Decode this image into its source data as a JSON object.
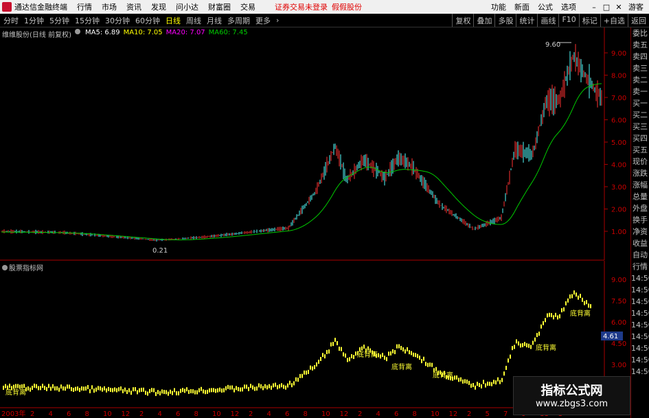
{
  "menubar": {
    "app_title": "通达信金融终端",
    "menus": [
      "行情",
      "市场",
      "资讯",
      "发现",
      "问小达",
      "财富圈",
      "交易"
    ],
    "warning": "证券交易未登录",
    "warning2": "假假股份",
    "right": [
      "功能",
      "新面",
      "公式",
      "选项"
    ],
    "user": "游客"
  },
  "toolbar": {
    "timeframes": [
      "分时",
      "1分钟",
      "5分钟",
      "15分钟",
      "30分钟",
      "60分钟",
      "日线",
      "周线",
      "月线",
      "多周期",
      "更多"
    ],
    "active_timeframe": "日线",
    "right_tools": [
      "复权",
      "叠加",
      "多股",
      "统计",
      "画线",
      "F10",
      "标记",
      "+自选",
      "返回"
    ]
  },
  "main_chart": {
    "stock": "维维股份(日线 前复权)",
    "ma5": "MA5: 6.89",
    "ma10": "MA10: 7.05",
    "ma20": "MA20: 7.07",
    "ma60": "MA60: 7.45",
    "high_label": "9.60",
    "low_label": "0.21",
    "y_ticks": [
      "9.00",
      "8.00",
      "7.00",
      "6.00",
      "5.00",
      "4.00",
      "3.00",
      "2.00",
      "1.00"
    ],
    "ma_colors": {
      "ma5": "#ffffff",
      "ma10": "#ffff00",
      "ma20": "#ff00ff",
      "ma60": "#00cc00"
    }
  },
  "indicator": {
    "title": "股票指标网",
    "y_ticks": [
      "9.00",
      "7.50",
      "6.00",
      "4.50",
      "3.00"
    ],
    "current_value": "4.61",
    "signal_label": "底背离"
  },
  "x_axis": {
    "year_label": "2003年",
    "month_ticks": [
      "2",
      "4",
      "6",
      "8",
      "10",
      "12",
      "2",
      "4",
      "6",
      "8",
      "10",
      "12",
      "2",
      "4",
      "6",
      "8",
      "10",
      "12",
      "2",
      "4",
      "6",
      "8",
      "10",
      "12",
      "2",
      "5",
      "7",
      "9",
      "11",
      "1"
    ]
  },
  "right_panel": {
    "items": [
      "委比",
      "卖五",
      "卖四",
      "卖三",
      "卖二",
      "卖一",
      "买一",
      "买二",
      "买三",
      "买四",
      "买五",
      "现价",
      "涨跌",
      "涨幅",
      "总量",
      "外盘",
      "换手",
      "净资",
      "收益",
      "自动",
      "行情",
      "14:50",
      "14:50",
      "14:50",
      "14:50",
      "14:50",
      "14:50",
      "14:50",
      "14:50",
      "14:50"
    ]
  },
  "watermark": {
    "title": "指标公式网",
    "url": "www.zbgs3.com"
  }
}
